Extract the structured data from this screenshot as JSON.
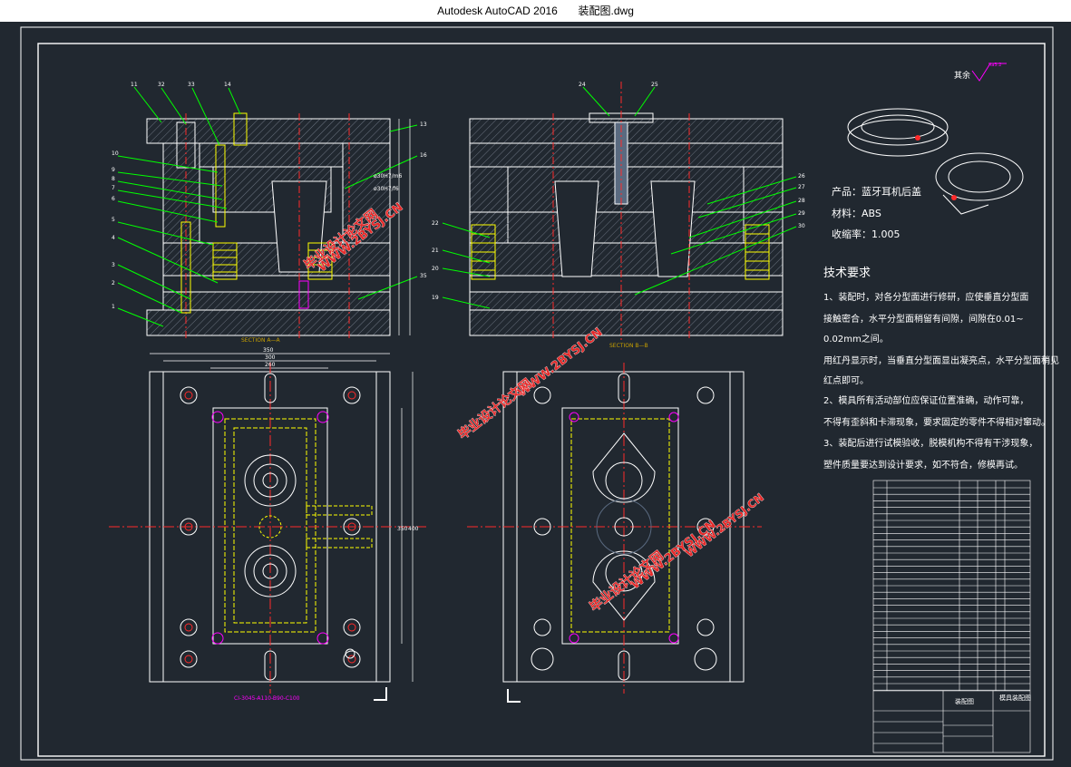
{
  "window": {
    "app": "Autodesk AutoCAD 2016",
    "file": "装配图.dwg"
  },
  "drawing": {
    "section_left": "SECTION A—A",
    "section_right": "SECTION B—B",
    "roughness": "其余",
    "roughness_value": "Ra3.2",
    "dims": {
      "d350": "350",
      "d300": "300",
      "d260": "260",
      "d350v": "350",
      "d400v": "400",
      "fit1": "ø30H7/m6",
      "fit2": "ø30H7/f6"
    },
    "mold_code": "CI-3045-A110-B90-C100",
    "callouts_left": [
      "11",
      "32",
      "33",
      "14",
      "10",
      "9",
      "8",
      "7",
      "6",
      "5",
      "4",
      "3",
      "2",
      "1",
      "13",
      "16",
      "35"
    ],
    "callouts_right": [
      "24",
      "25",
      "26",
      "27",
      "28",
      "29",
      "30",
      "22",
      "21",
      "20",
      "19"
    ],
    "product": {
      "name": "产品：蓝牙耳机后盖",
      "material": "材料：ABS",
      "shrink": "收缩率：1.005"
    },
    "tech": {
      "heading": "技术要求",
      "lines": [
        "1、装配时，对各分型面进行修研，应使垂直分型面",
        "接触密合，水平分型面稍留有间隙，间隙在0.01~",
        "0.02mm之间。",
        "用红丹显示时，当垂直分型面显出凝亮点，水平分型面稍见",
        "红点即可。",
        "2、模具所有活动部位应保证位置准确，动作可靠，",
        "不得有歪斜和卡滞现象，要求固定的零件不得相对窜动。",
        "3、装配后进行试模验收，脱模机构不得有干涉现象，",
        "塑件质量要达到设计要求，如不符合，修模再试。"
      ]
    },
    "watermarks": [
      "WWW.2BYSJ.CN",
      "毕业设计论文网"
    ],
    "title_block": {
      "drawing_name": "装配图",
      "design_title": "模具装配图"
    }
  },
  "colors": {
    "bg": "#212830",
    "frame": "#ffffff",
    "yellow": "#ffff00",
    "green": "#00ff00",
    "red": "#ff2a2a",
    "magenta": "#ff00ff",
    "hatch": "#6b7380"
  }
}
